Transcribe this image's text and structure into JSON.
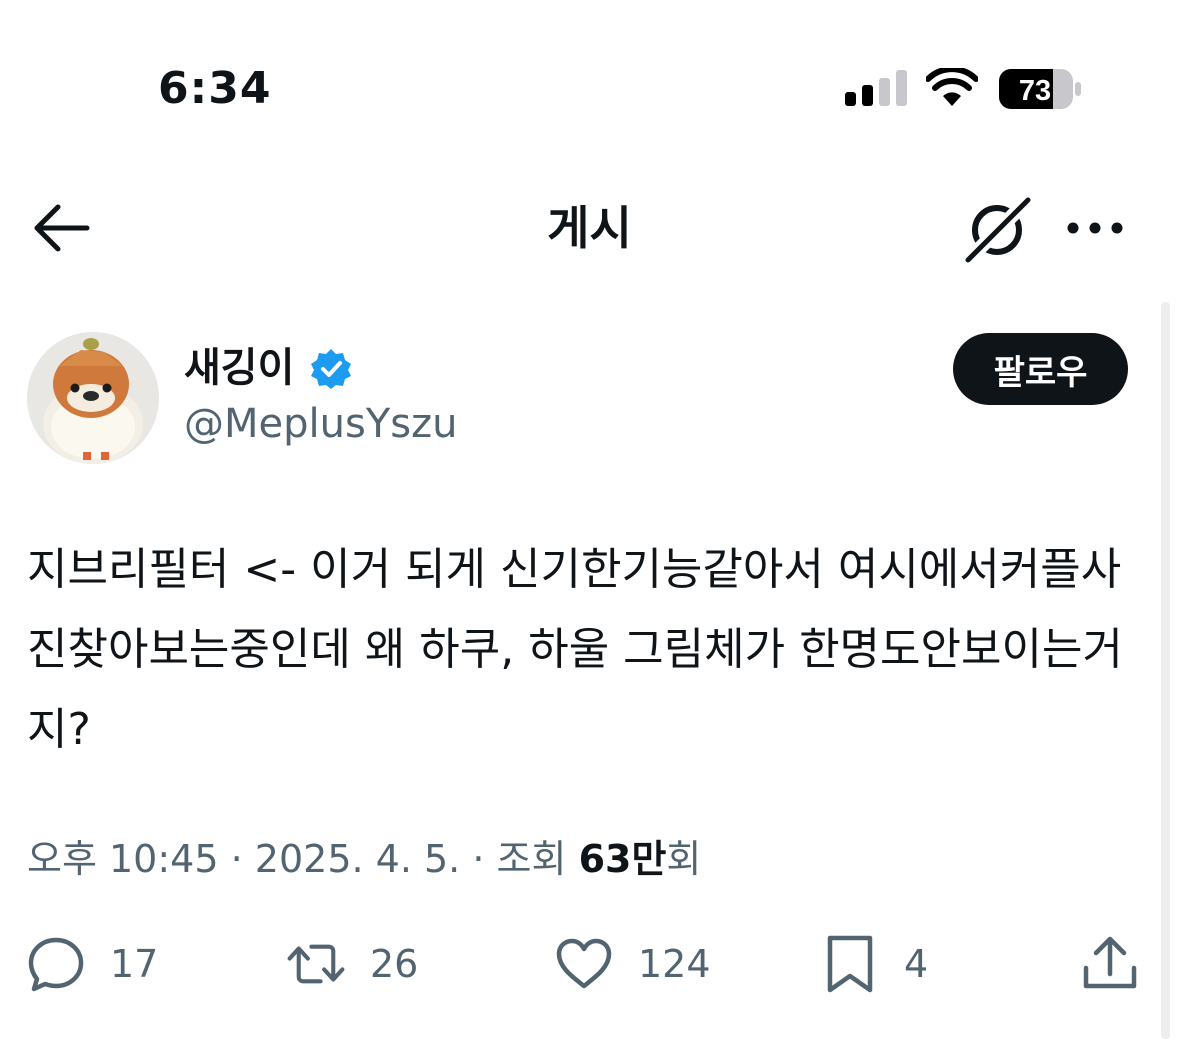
{
  "status_bar": {
    "time": "6:34",
    "battery_level": "73"
  },
  "header": {
    "title": "게시",
    "icons": [
      "back-arrow-icon",
      "grok-icon",
      "more-icon"
    ]
  },
  "author": {
    "display_name": "새깅이",
    "handle": "@MeplusYszu",
    "verified": true,
    "follow_label": "팔로우"
  },
  "tweet": {
    "text": "지브리필터 <- 이거 되게 신기한기능같아서 여시에서커플사진찾아보는중인데 왜 하쿠, 하울 그림체가 한명도안보이는거지?",
    "time": "오후 10:45",
    "separator": "·",
    "date": "2025. 4. 5.",
    "views_label": "조회",
    "views_number": "63만",
    "views_suffix": "회"
  },
  "actions": {
    "replies": "17",
    "retweets": "26",
    "likes": "124",
    "bookmarks": "4"
  },
  "colors": {
    "text_primary": "#0f1419",
    "text_secondary": "#536471",
    "verified_blue": "#1d9bf0",
    "follow_bg": "#0f1419"
  }
}
